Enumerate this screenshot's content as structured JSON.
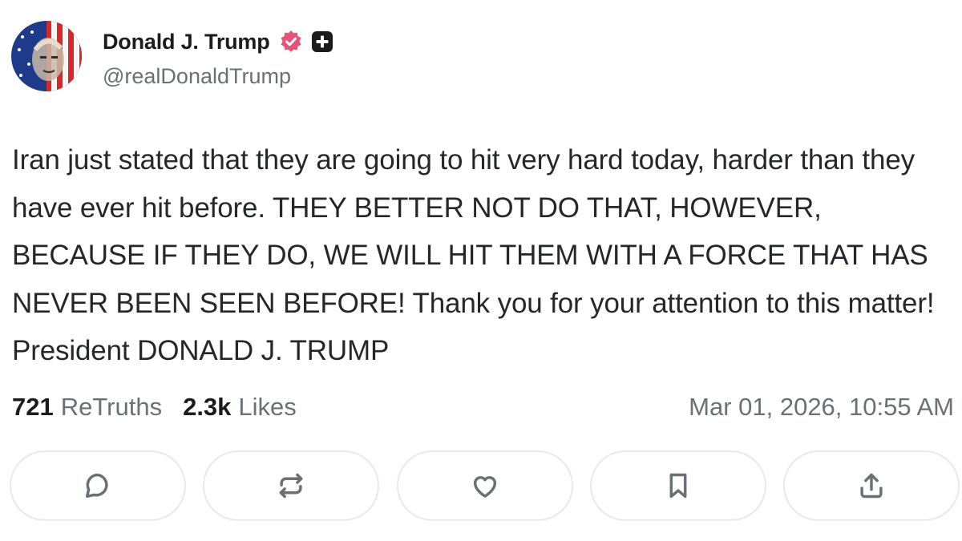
{
  "post": {
    "author": {
      "display_name": "Donald J. Trump",
      "handle": "@realDonaldTrump",
      "verified": true
    },
    "text": "Iran just stated that they are going to hit very hard today, harder than they have ever hit before. THEY BETTER NOT DO THAT, HOWEVER, BECAUSE IF THEY DO, WE WILL HIT THEM WITH A FORCE THAT HAS NEVER BEEN SEEN BEFORE! Thank you for your attention to this matter! President DONALD J. TRUMP",
    "stats": {
      "retruths_count": "721",
      "retruths_label": "ReTruths",
      "likes_count": "2.3k",
      "likes_label": "Likes"
    },
    "timestamp": "Mar 01, 2026, 10:55 AM"
  },
  "actions": [
    {
      "name": "reply",
      "icon": "comment-icon"
    },
    {
      "name": "retruth",
      "icon": "repost-icon"
    },
    {
      "name": "like",
      "icon": "heart-icon"
    },
    {
      "name": "bookmark",
      "icon": "bookmark-icon"
    },
    {
      "name": "share",
      "icon": "share-icon"
    }
  ],
  "colors": {
    "verified_badge": "#e8527a",
    "text_primary": "#1c1c1e",
    "text_secondary": "#6b6f76",
    "button_border": "#e8e9ec"
  }
}
